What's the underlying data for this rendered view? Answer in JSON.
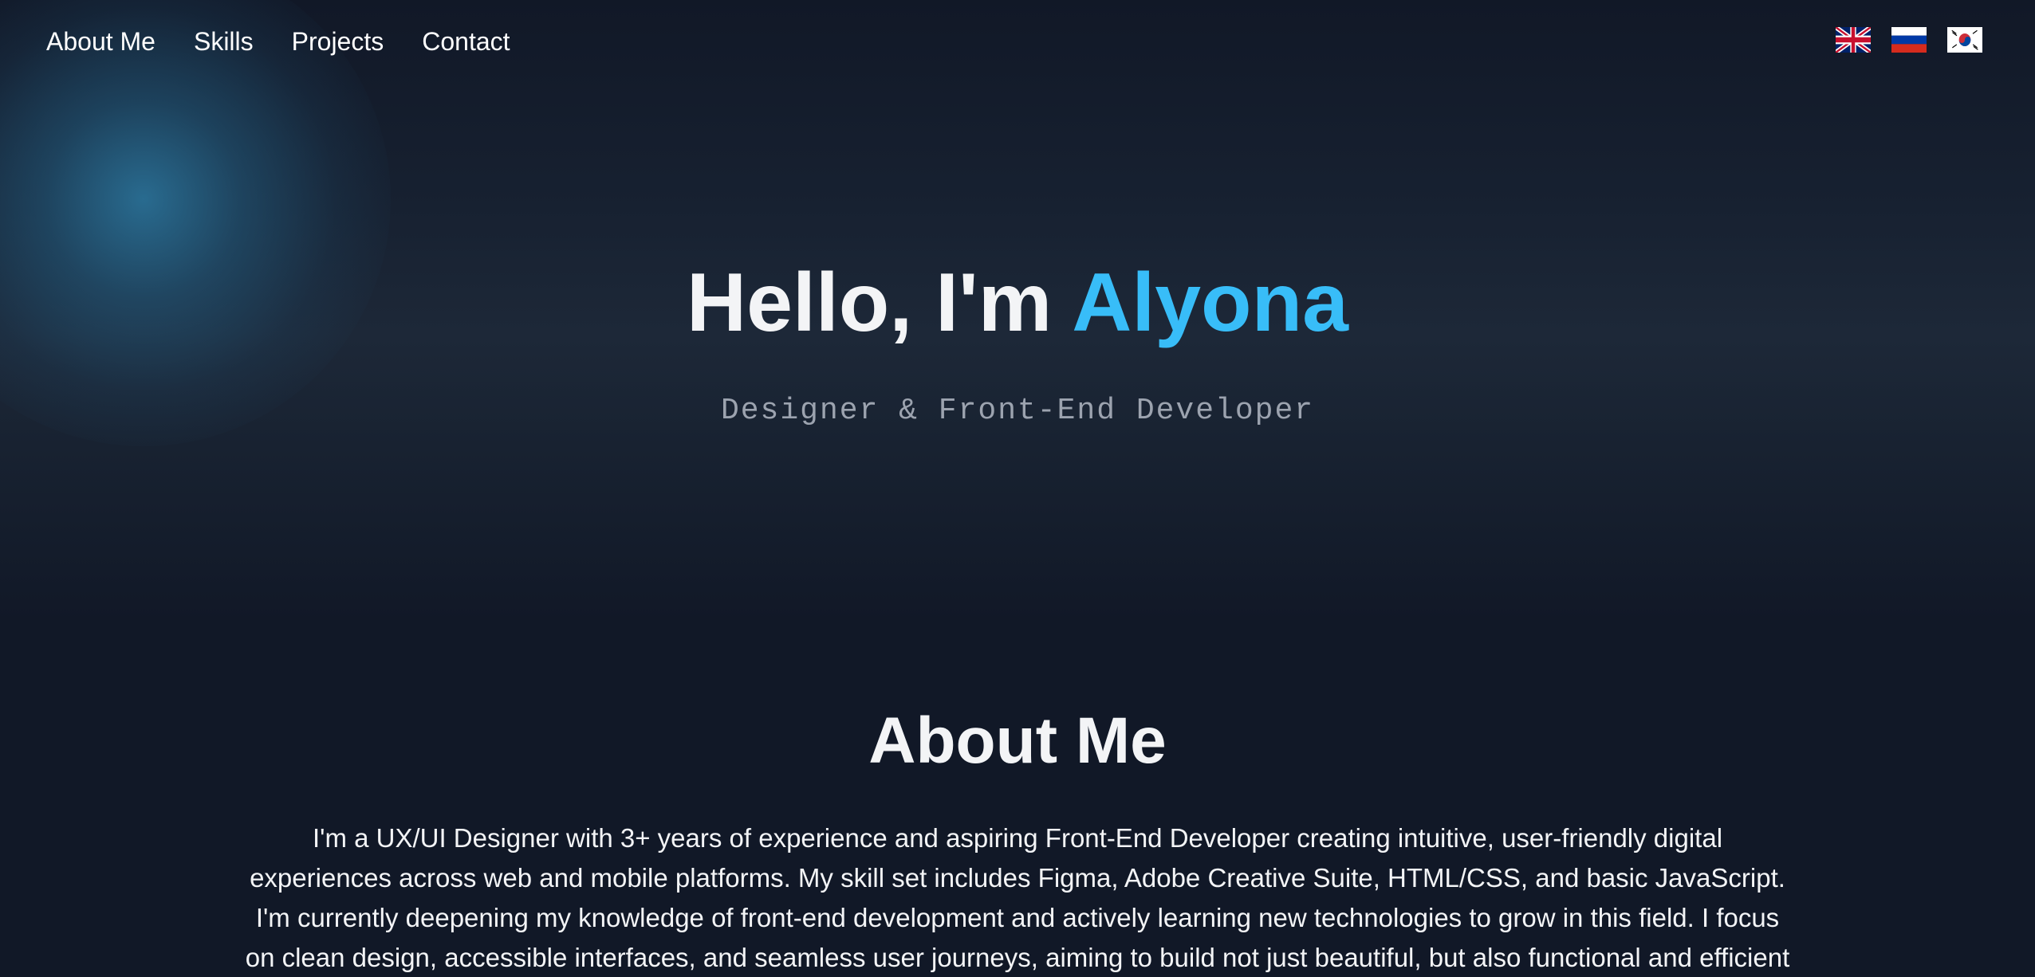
{
  "nav": {
    "items": [
      {
        "label": "About Me"
      },
      {
        "label": "Skills"
      },
      {
        "label": "Projects"
      },
      {
        "label": "Contact"
      }
    ]
  },
  "languages": [
    "uk-flag-icon",
    "russia-flag-icon",
    "south-korea-flag-icon"
  ],
  "hero": {
    "greeting": "Hello, I'm ",
    "name": "Alyona",
    "subtitle": "Designer & Front-End Developer"
  },
  "about": {
    "title": "About Me",
    "text": "I'm a UX/UI Designer with 3+ years of experience and aspiring Front-End Developer creating intuitive, user-friendly digital experiences across web and mobile platforms. My skill set includes Figma, Adobe Creative Suite, HTML/CSS, and basic JavaScript. I'm currently deepening my knowledge of front-end development and actively learning new technologies to grow in this field. I focus on clean design, accessible interfaces, and seamless user journeys, aiming to build not just beautiful, but also functional and efficient digital products."
  },
  "colors": {
    "background": "#111827",
    "accent": "#38bdf8",
    "text": "#f3f4f6",
    "muted": "#9ca3af"
  }
}
